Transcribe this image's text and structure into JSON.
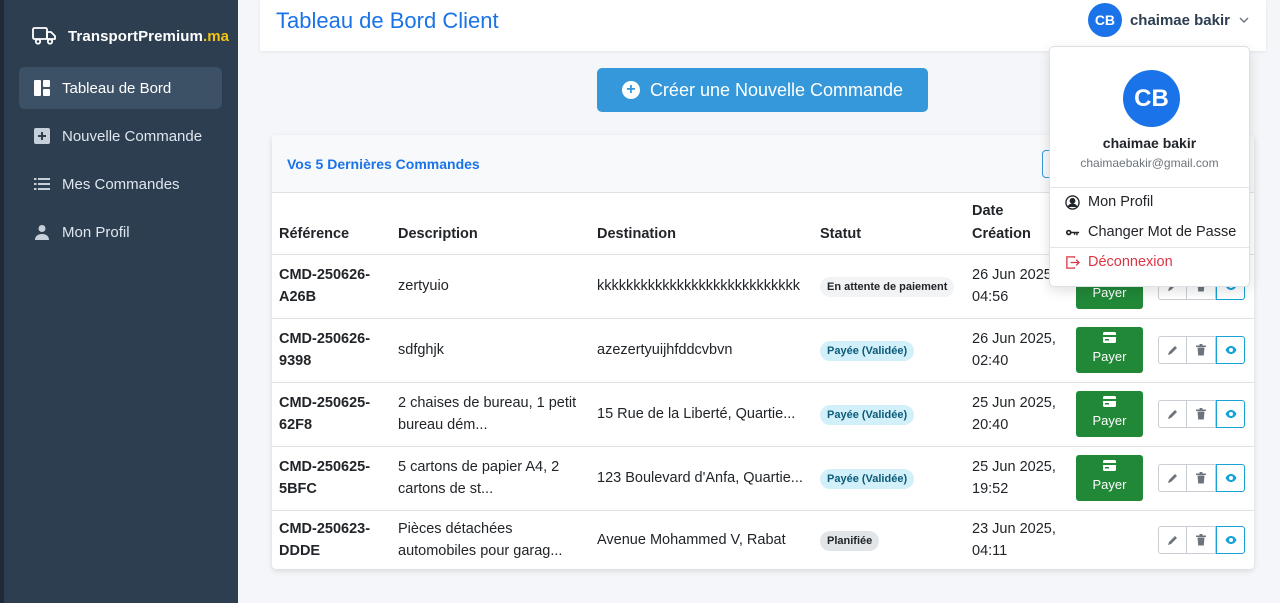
{
  "brand": {
    "name": "TransportPremium",
    "tld": ".ma",
    "icon": "truck-icon"
  },
  "sidebar": {
    "items": [
      {
        "label": "Tableau de Bord",
        "icon": "dashboard-icon",
        "active": true
      },
      {
        "label": "Nouvelle Commande",
        "icon": "plus-square-icon",
        "active": false
      },
      {
        "label": "Mes Commandes",
        "icon": "list-icon",
        "active": false
      },
      {
        "label": "Mon Profil",
        "icon": "user-icon",
        "active": false
      }
    ]
  },
  "header": {
    "title": "Tableau de Bord Client",
    "user": {
      "initials": "CB",
      "name": "chaimae bakir"
    }
  },
  "create_button": {
    "label": "Créer une Nouvelle Commande"
  },
  "orders": {
    "title": "Vos 5 Dernières Commandes",
    "columns": [
      "Référence",
      "Description",
      "Destination",
      "Statut",
      "Date Création"
    ],
    "pay_label": "Payer",
    "rows": [
      {
        "ref": "CMD-250626-A26B",
        "description": "zertyuio",
        "destination": "kkkkkkkkkkkkkkkkkkkkkkkkkkkk",
        "status": "En attente de paiement",
        "date": "26 Jun 2025, 04:56"
      },
      {
        "ref": "CMD-250626-9398",
        "description": "sdfghjk",
        "destination": "azezertyuijhfddcvbvn",
        "status": "Payée (Validée)",
        "date": "26 Jun 2025, 02:40"
      },
      {
        "ref": "CMD-250625-62F8",
        "description": "2 chaises de bureau, 1 petit bureau dém...",
        "destination": "15 Rue de la Liberté, Quartie...",
        "status": "Payée (Validée)",
        "date": "25 Jun 2025, 20:40"
      },
      {
        "ref": "CMD-250625-5BFC",
        "description": "5 cartons de papier A4, 2 cartons de st...",
        "destination": "123 Boulevard d'Anfa, Quartie...",
        "status": "Payée (Validée)",
        "date": "25 Jun 2025, 19:52"
      },
      {
        "ref": "CMD-250623-DDDE",
        "description": "Pièces détachées automobiles pour garag...",
        "destination": "Avenue Mohammed V, Rabat",
        "status": "Planifiée",
        "date": "23 Jun 2025, 04:11"
      }
    ]
  },
  "dropdown": {
    "initials": "CB",
    "name": "chaimae bakir",
    "email": "chaimaebakir@gmail.com",
    "items": [
      {
        "label": "Mon Profil",
        "icon": "user-circle-icon"
      },
      {
        "label": "Changer Mot de Passe",
        "icon": "key-icon"
      },
      {
        "label": "Déconnexion",
        "icon": "logout-icon"
      }
    ]
  },
  "colors": {
    "primary": "#1a73e8",
    "sidebar": "#2c3e50",
    "success": "#218838",
    "info": "#17a2d8",
    "danger": "#dc3545",
    "brand_accent": "#f1c40f"
  }
}
